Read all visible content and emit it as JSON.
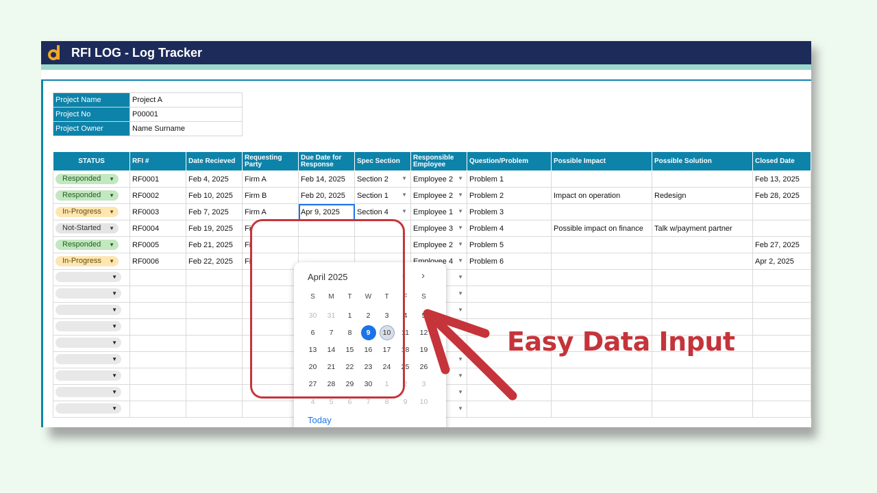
{
  "app": {
    "title": "RFI LOG - Log Tracker",
    "logo_icon": "d-logo-icon"
  },
  "project_info": [
    {
      "label": "Project Name",
      "value": "Project A"
    },
    {
      "label": "Project No",
      "value": "P00001"
    },
    {
      "label": "Project Owner",
      "value": "Name Surname"
    }
  ],
  "table": {
    "headers": [
      "STATUS",
      "RFI #",
      "Date Recieved",
      "Requesting Party",
      "Due Date for Response",
      "Spec Section",
      "Responsible Employee",
      "Question/Problem",
      "Possible Impact",
      "Possible Solution",
      "Closed Date"
    ],
    "rows": [
      {
        "status": "Responded",
        "rfi": "RF0001",
        "received": "Feb 4, 2025",
        "party": "Firm A",
        "due": "Feb 14, 2025",
        "spec": "Section 2",
        "employee": "Employee 2",
        "question": "Problem 1",
        "impact": "",
        "solution": "",
        "closed": "Feb 13, 2025"
      },
      {
        "status": "Responded",
        "rfi": "RF0002",
        "received": "Feb 10, 2025",
        "party": "Firm B",
        "due": "Feb 20, 2025",
        "spec": "Section 1",
        "employee": "Employee 2",
        "question": "Problem 2",
        "impact": "Impact on operation",
        "solution": "Redesign",
        "closed": "Feb 28, 2025"
      },
      {
        "status": "In-Progress",
        "rfi": "RF0003",
        "received": "Feb 7, 2025",
        "party": "Firm A",
        "due": "Apr 9, 2025",
        "spec": "Section 4",
        "employee": "Employee 1",
        "question": "Problem 3",
        "impact": "",
        "solution": "",
        "closed": ""
      },
      {
        "status": "Not-Started",
        "rfi": "RF0004",
        "received": "Feb 19, 2025",
        "party": "Fi",
        "due": "",
        "spec": "",
        "employee": "Employee 3",
        "question": "Problem 4",
        "impact": "Possible impact on finance",
        "solution": "Talk w/payment partner",
        "closed": ""
      },
      {
        "status": "Responded",
        "rfi": "RF0005",
        "received": "Feb 21, 2025",
        "party": "Fi",
        "due": "",
        "spec": "",
        "employee": "Employee 2",
        "question": "Problem 5",
        "impact": "",
        "solution": "",
        "closed": "Feb 27, 2025"
      },
      {
        "status": "In-Progress",
        "rfi": "RF0006",
        "received": "Feb 22, 2025",
        "party": "Fi",
        "due": "",
        "spec": "",
        "employee": "Employee 4",
        "question": "Problem 6",
        "impact": "",
        "solution": "",
        "closed": "Apr 2, 2025"
      }
    ],
    "empty_rows": 9
  },
  "calendar": {
    "month": "April 2025",
    "prev_icon": "chevron-left-icon",
    "next_icon": "chevron-right-icon",
    "weekdays": [
      "S",
      "M",
      "T",
      "W",
      "T",
      "F",
      "S"
    ],
    "days": [
      "30",
      "31",
      "1",
      "2",
      "3",
      "4",
      "5",
      "6",
      "7",
      "8",
      "9",
      "10",
      "11",
      "12",
      "13",
      "14",
      "15",
      "16",
      "17",
      "18",
      "19",
      "20",
      "21",
      "22",
      "23",
      "24",
      "25",
      "26",
      "27",
      "28",
      "29",
      "30",
      "1",
      "2",
      "3",
      "4",
      "5",
      "6",
      "7",
      "8",
      "9",
      "10"
    ],
    "selected": "9",
    "highlighted": "10",
    "today_label": "Today"
  },
  "callout": {
    "text": "Easy Data Input",
    "color": "#c5343a"
  },
  "colors": {
    "navy": "#1c2b5a",
    "teal_header": "#0e83aa",
    "accent_band": "#9bdacb",
    "selection": "#1a73e8"
  }
}
